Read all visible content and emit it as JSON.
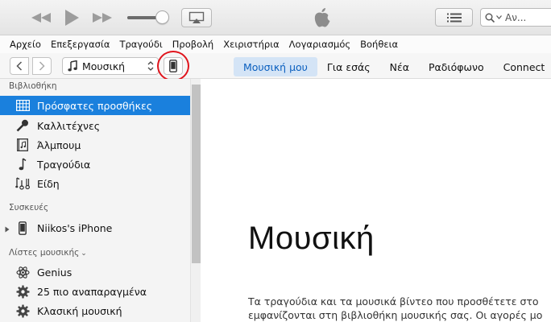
{
  "player": {
    "search_text": "Αν..."
  },
  "menu": [
    "Αρχείο",
    "Επεξεργασία",
    "Τραγούδι",
    "Προβολή",
    "Χειριστήρια",
    "Λογαριασμός",
    "Βοήθεια"
  ],
  "nav": {
    "media_label": "Μουσική",
    "tabs": [
      {
        "label": "Μουσική μου",
        "active": true
      },
      {
        "label": "Για εσάς",
        "active": false
      },
      {
        "label": "Νέα",
        "active": false
      },
      {
        "label": "Ραδιόφωνο",
        "active": false
      },
      {
        "label": "Connect",
        "active": false
      }
    ]
  },
  "sidebar": {
    "library_title": "Βιβλιοθήκη",
    "library": [
      {
        "label": "Πρόσφατες προσθήκες",
        "icon": "grid-icon",
        "selected": true
      },
      {
        "label": "Καλλιτέχνες",
        "icon": "microphone-icon",
        "selected": false
      },
      {
        "label": "Άλμπουμ",
        "icon": "album-icon",
        "selected": false
      },
      {
        "label": "Τραγούδια",
        "icon": "music-note-icon",
        "selected": false
      },
      {
        "label": "Είδη",
        "icon": "genres-icon",
        "selected": false
      }
    ],
    "devices_title": "Συσκευές",
    "devices": [
      {
        "label": "Niikos's iPhone",
        "icon": "iphone-icon"
      }
    ],
    "playlists_title": "Λίστες μουσικής",
    "playlists": [
      {
        "label": "Genius",
        "icon": "genius-icon"
      },
      {
        "label": "25 πιο αναπαραγμένα",
        "icon": "gear-icon"
      },
      {
        "label": "Κλασική μουσική",
        "icon": "gear-icon"
      }
    ]
  },
  "main": {
    "heading": "Μουσική",
    "desc_line1": "Τα τραγούδια και τα μουσικά βίντεο που προσθέτετε στο",
    "desc_line2": "εμφανίζονται στη βιβλιοθήκη μουσικής σας. Οι αγορές μο"
  },
  "colors": {
    "selection": "#1a80dd",
    "tab_active_bg": "#d4e4f6",
    "tab_active_text": "#0a5fbf",
    "highlight_circle": "#e0141c"
  }
}
